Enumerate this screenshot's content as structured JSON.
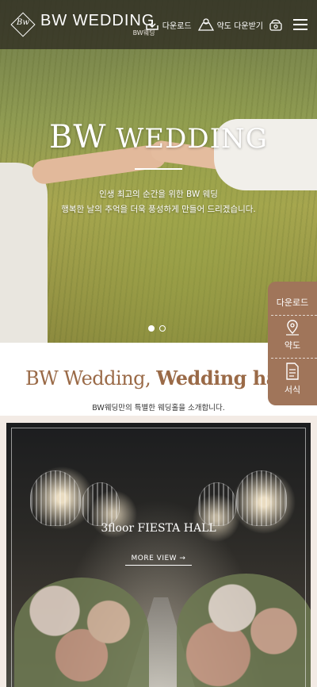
{
  "header": {
    "logo_mark": "Bw",
    "logo_title": "BW WEDDING",
    "logo_sub": "BW웨딩",
    "download_label": "다운로드",
    "map_download_label": "약도 다운받기",
    "phone_icon": "phone-icon",
    "menu_icon": "hamburger-menu-icon"
  },
  "hero": {
    "title_prefix": "BW",
    "title_rest": "WEDDING",
    "line1": "인생 최고의 순간을 위한 BW 웨딩",
    "line2": "행복한 날의 추억을 더욱 풍성하게 만들어 드리겠습니다.",
    "slide_count": 2,
    "active_slide": 1
  },
  "quick_menu": {
    "title": "다운로드",
    "map_label": "약도",
    "form_label": "서식"
  },
  "section": {
    "title_part1": "BW Wedding,",
    "title_part2": "Wedding hall",
    "subtitle": "BW웨딩만의 특별한 웨딩홀을 소개합니다."
  },
  "hall": {
    "name": "3floor FIESTA HALL",
    "more_label": "MORE VIEW →"
  },
  "colors": {
    "accent": "#9a6a47",
    "quick_bg": "#a0755a",
    "header_bg": "#28241e"
  }
}
